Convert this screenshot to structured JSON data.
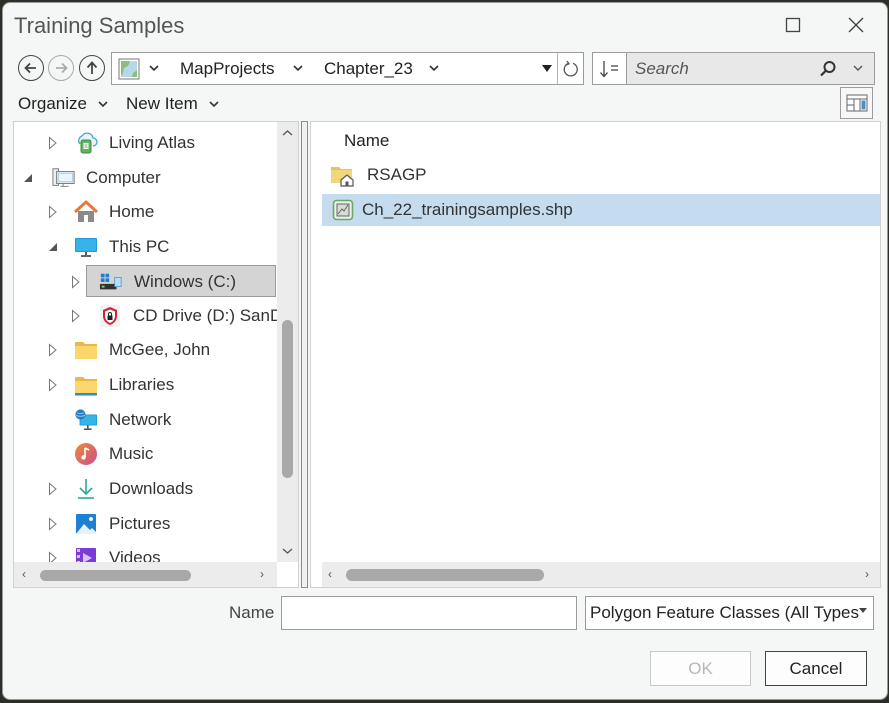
{
  "window": {
    "title": "Training Samples",
    "maximize_icon": "maximize-icon",
    "close_icon": "close-icon"
  },
  "nav": {
    "back_icon": "back-arrow-icon",
    "forward_icon": "forward-arrow-icon",
    "forward_enabled": false,
    "up_icon": "up-arrow-icon"
  },
  "address": {
    "location_icon": "map-project-icon",
    "segments": [
      "MapProjects",
      "Chapter_23"
    ],
    "refresh_icon": "refresh-icon"
  },
  "search": {
    "placeholder": "Search",
    "sort_icon": "sort-icon",
    "search_icon": "search-icon"
  },
  "toolbar": {
    "organize_label": "Organize",
    "new_item_label": "New Item",
    "layout_icon": "view-layout-icon"
  },
  "tree": {
    "items": [
      {
        "label": "Living Atlas",
        "icon": "living-atlas-icon",
        "expander": "collapsed",
        "level": 1
      },
      {
        "label": "Computer",
        "icon": "computer-icon",
        "expander": "expanded",
        "level": 0
      },
      {
        "label": "Home",
        "icon": "home-icon",
        "expander": "collapsed",
        "level": 1
      },
      {
        "label": "This PC",
        "icon": "monitor-icon",
        "expander": "expanded",
        "level": 1
      },
      {
        "label": "Windows (C:)",
        "icon": "windows-drive-icon",
        "expander": "collapsed",
        "level": 2,
        "selected": true
      },
      {
        "label": "CD Drive (D:) SanD",
        "icon": "secure-drive-icon",
        "expander": "collapsed",
        "level": 2
      },
      {
        "label": "McGee, John",
        "icon": "folder-icon",
        "expander": "collapsed",
        "level": 1
      },
      {
        "label": "Libraries",
        "icon": "libraries-icon",
        "expander": "collapsed",
        "level": 1
      },
      {
        "label": "Network",
        "icon": "network-icon",
        "expander": "none",
        "level": 1
      },
      {
        "label": "Music",
        "icon": "music-icon",
        "expander": "none",
        "level": 1
      },
      {
        "label": "Downloads",
        "icon": "download-icon",
        "expander": "collapsed",
        "level": 1
      },
      {
        "label": "Pictures",
        "icon": "pictures-icon",
        "expander": "collapsed",
        "level": 1
      },
      {
        "label": "Videos",
        "icon": "videos-icon",
        "expander": "collapsed",
        "level": 1
      }
    ]
  },
  "content": {
    "column_header": "Name",
    "items": [
      {
        "label": "RSAGP",
        "icon": "home-folder-icon",
        "selected": false
      },
      {
        "label": "Ch_22_trainingsamples.shp",
        "icon": "shapefile-icon",
        "selected": true
      }
    ]
  },
  "footer": {
    "name_label": "Name",
    "name_value": "",
    "filter_value": "Polygon Feature Classes (All Types",
    "ok_label": "OK",
    "ok_enabled": false,
    "cancel_label": "Cancel"
  },
  "colors": {
    "selection_bg": "#c5dcee",
    "tree_selection_bg": "#d4d4d4",
    "dialog_bg": "#f5f6f6"
  }
}
